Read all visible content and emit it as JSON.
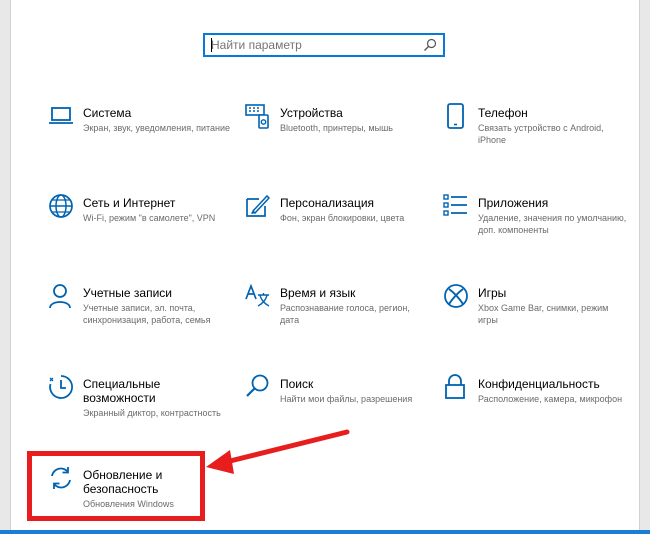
{
  "search": {
    "placeholder": "Найти параметр"
  },
  "tiles": [
    {
      "title": "Система",
      "desc": "Экран, звук, уведомления, питание",
      "icon": "laptop-icon"
    },
    {
      "title": "Устройства",
      "desc": "Bluetooth, принтеры, мышь",
      "icon": "devices-icon"
    },
    {
      "title": "Телефон",
      "desc": "Связать устройство с Android, iPhone",
      "icon": "phone-icon"
    },
    {
      "title": "Сеть и Интернет",
      "desc": "Wi-Fi, режим \"в самолете\", VPN",
      "icon": "globe-icon"
    },
    {
      "title": "Персонализация",
      "desc": "Фон, экран блокировки, цвета",
      "icon": "paint-icon"
    },
    {
      "title": "Приложения",
      "desc": "Удаление, значения по умолчанию, доп. компоненты",
      "icon": "apps-icon"
    },
    {
      "title": "Учетные записи",
      "desc": "Учетные записи, эл. почта, синхронизация, работа, семья",
      "icon": "person-icon"
    },
    {
      "title": "Время и язык",
      "desc": "Распознавание голоса, регион, дата",
      "icon": "time-language-icon"
    },
    {
      "title": "Игры",
      "desc": "Xbox Game Bar, снимки, режим игры",
      "icon": "xbox-icon"
    },
    {
      "title": "Специальные возможности",
      "desc": "Экранный диктор, контрастность",
      "icon": "accessibility-icon"
    },
    {
      "title": "Поиск",
      "desc": "Найти мои файлы, разрешения",
      "icon": "search-icon"
    },
    {
      "title": "Конфиденциальность",
      "desc": "Расположение, камера, микрофон",
      "icon": "lock-icon"
    },
    {
      "title": "Обновление и безопасность",
      "desc": "Обновления Windows",
      "icon": "update-icon"
    }
  ],
  "colors": {
    "accent": "#0063b1",
    "highlight": "#e81d1d",
    "search_border": "#0a78d7"
  }
}
